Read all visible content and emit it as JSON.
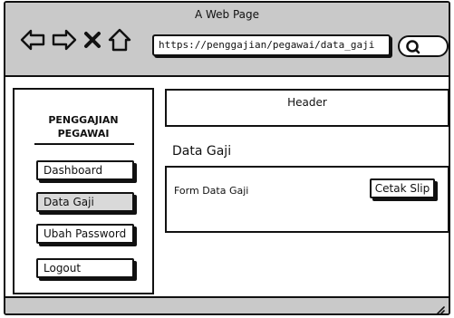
{
  "browser": {
    "title": "A Web Page",
    "url": "https://penggajian/pegawai/data_gaji",
    "icons": [
      "back-arrow-icon",
      "forward-arrow-icon",
      "close-icon",
      "home-icon",
      "search-icon",
      "resize-grip-icon"
    ]
  },
  "sidebar": {
    "brand_line1": "PENGGAJIAN",
    "brand_line2": "PEGAWAI",
    "items": [
      {
        "label": "Dashboard"
      },
      {
        "label": "Data Gaji"
      },
      {
        "label": "Ubah Password"
      },
      {
        "label": "Logout"
      }
    ],
    "active_item": "Data Gaji"
  },
  "main": {
    "header": "Header",
    "section_title": "Data Gaji",
    "form_label": "Form Data Gaji",
    "print_button": "Cetak Slip"
  },
  "colors": {
    "chrome": "#c9c9c9",
    "active_item": "#d9d9d9",
    "stroke": "#111111"
  }
}
